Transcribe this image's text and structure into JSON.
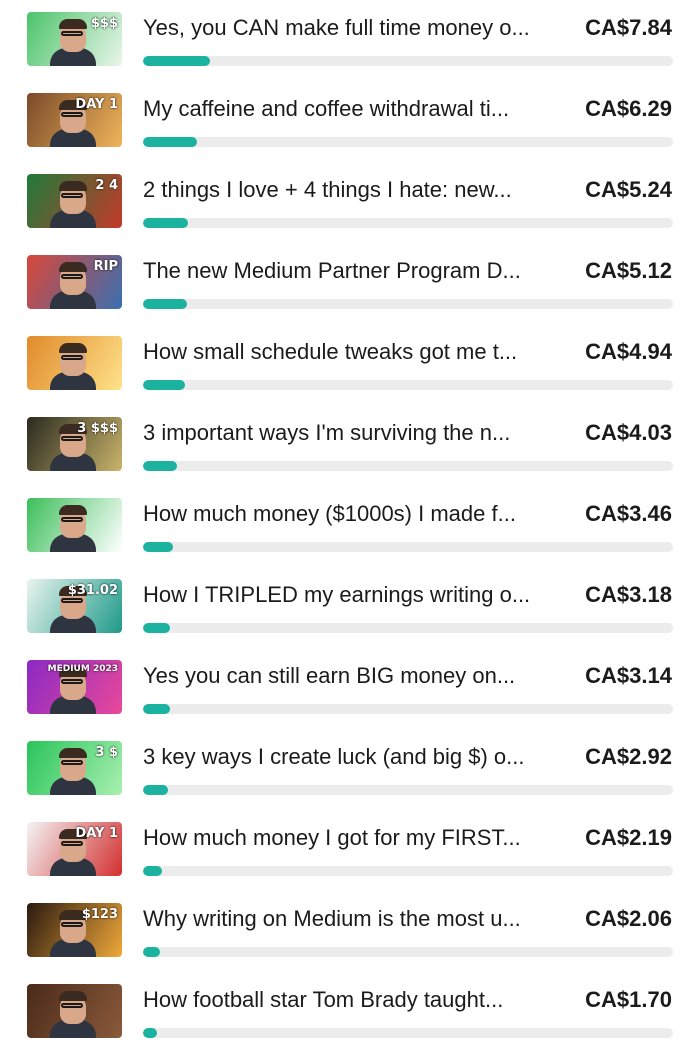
{
  "items": [
    {
      "title": "Yes, you CAN make full time money o...",
      "amount": "CA$7.84",
      "progress": 0.126,
      "thumb_color": "#4cc46a",
      "thumb_color2": "#e9f5ea",
      "thumb_tag": "$$$",
      "thumb_icon": "person-thumbnail-icon"
    },
    {
      "title": "My caffeine and coffee withdrawal ti...",
      "amount": "CA$6.29",
      "progress": 0.102,
      "thumb_color": "#7a4a2a",
      "thumb_color2": "#f0b55a",
      "thumb_tag": "DAY 1",
      "thumb_icon": "person-thumbnail-icon"
    },
    {
      "title": "2 things I love + 4 things I hate: new...",
      "amount": "CA$5.24",
      "progress": 0.085,
      "thumb_color": "#1f7a3a",
      "thumb_color2": "#c43a2a",
      "thumb_tag": "2   4",
      "thumb_icon": "person-thumbnail-icon"
    },
    {
      "title": "The new Medium Partner Program D...",
      "amount": "CA$5.12",
      "progress": 0.083,
      "thumb_color": "#d9473a",
      "thumb_color2": "#3a6fb0",
      "thumb_tag": "RIP",
      "thumb_icon": "person-thumbnail-icon"
    },
    {
      "title": "How small schedule tweaks got me t...",
      "amount": "CA$4.94",
      "progress": 0.08,
      "thumb_color": "#e08a2a",
      "thumb_color2": "#ffe28a",
      "thumb_tag": "",
      "thumb_icon": "person-thumbnail-icon"
    },
    {
      "title": "3 important ways I'm surviving the n...",
      "amount": "CA$4.03",
      "progress": 0.065,
      "thumb_color": "#2a2a20",
      "thumb_color2": "#c9b46a",
      "thumb_tag": "3 $$$",
      "thumb_icon": "person-thumbnail-icon"
    },
    {
      "title": "How much money ($1000s) I made f...",
      "amount": "CA$3.46",
      "progress": 0.056,
      "thumb_color": "#3cbf5a",
      "thumb_color2": "#ffffff",
      "thumb_tag": "",
      "thumb_icon": "person-thumbnail-icon"
    },
    {
      "title": "How I TRIPLED my earnings writing o...",
      "amount": "CA$3.18",
      "progress": 0.051,
      "thumb_color": "#e8f4ee",
      "thumb_color2": "#1f9a8a",
      "thumb_tag": "$31.02",
      "thumb_icon": "person-thumbnail-icon"
    },
    {
      "title": "Yes you can still earn BIG money on...",
      "amount": "CA$3.14",
      "progress": 0.051,
      "thumb_color": "#8a2ac4",
      "thumb_color2": "#e8489a",
      "thumb_tag": "MEDIUM 2023",
      "thumb_icon": "person-thumbnail-icon"
    },
    {
      "title": "3 key ways I create luck (and big $) o...",
      "amount": "CA$2.92",
      "progress": 0.047,
      "thumb_color": "#2ac45a",
      "thumb_color2": "#a8f0b0",
      "thumb_tag": "3  $",
      "thumb_icon": "person-thumbnail-icon"
    },
    {
      "title": "How much money I got for my FIRST...",
      "amount": "CA$2.19",
      "progress": 0.035,
      "thumb_color": "#f4f4f4",
      "thumb_color2": "#d32f2f",
      "thumb_tag": "DAY 1",
      "thumb_icon": "person-thumbnail-icon"
    },
    {
      "title": "Why writing on Medium is the most u...",
      "amount": "CA$2.06",
      "progress": 0.033,
      "thumb_color": "#2a1a10",
      "thumb_color2": "#f0a83a",
      "thumb_tag": "$123",
      "thumb_icon": "person-thumbnail-icon"
    },
    {
      "title": "How football star Tom Brady taught...",
      "amount": "CA$1.70",
      "progress": 0.027,
      "thumb_color": "#4a2a1a",
      "thumb_color2": "#8a5a3a",
      "thumb_tag": "",
      "thumb_icon": "person-thumbnail-icon"
    }
  ],
  "colors": {
    "accent": "#1bb3a0",
    "track": "#ececec",
    "text": "#1b1b1b"
  }
}
